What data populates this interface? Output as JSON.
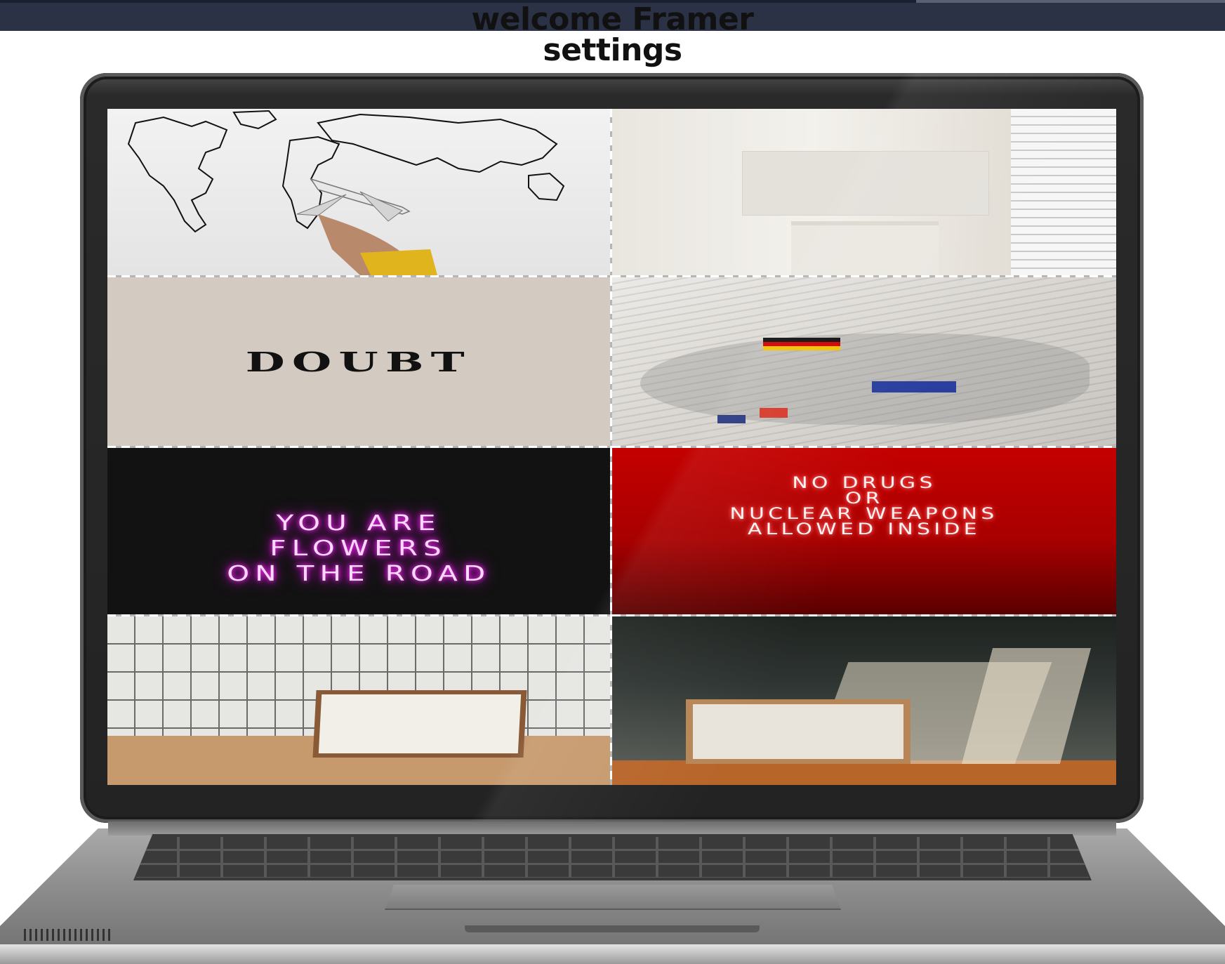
{
  "header": {
    "title_line1": "welcome Framer",
    "title_line2": "settings"
  },
  "gallery": {
    "tiles": [
      {
        "name": "world-map-airplane",
        "caption": ""
      },
      {
        "name": "white-wall-frame",
        "caption": ""
      },
      {
        "name": "doubt-poster",
        "caption": "DOUBT"
      },
      {
        "name": "newspaper-map",
        "caption": ""
      },
      {
        "name": "pink-neon-sign",
        "lines": [
          "YOU ARE",
          "FLOWERS",
          "ON THE ROAD"
        ]
      },
      {
        "name": "red-neon-sign",
        "lines": [
          "NO DRUGS",
          "OR",
          "NUCLEAR WEAPONS",
          "ALLOWED INSIDE"
        ]
      },
      {
        "name": "tiled-wall-frame",
        "caption": ""
      },
      {
        "name": "shadow-wall-frame",
        "caption": ""
      }
    ]
  }
}
